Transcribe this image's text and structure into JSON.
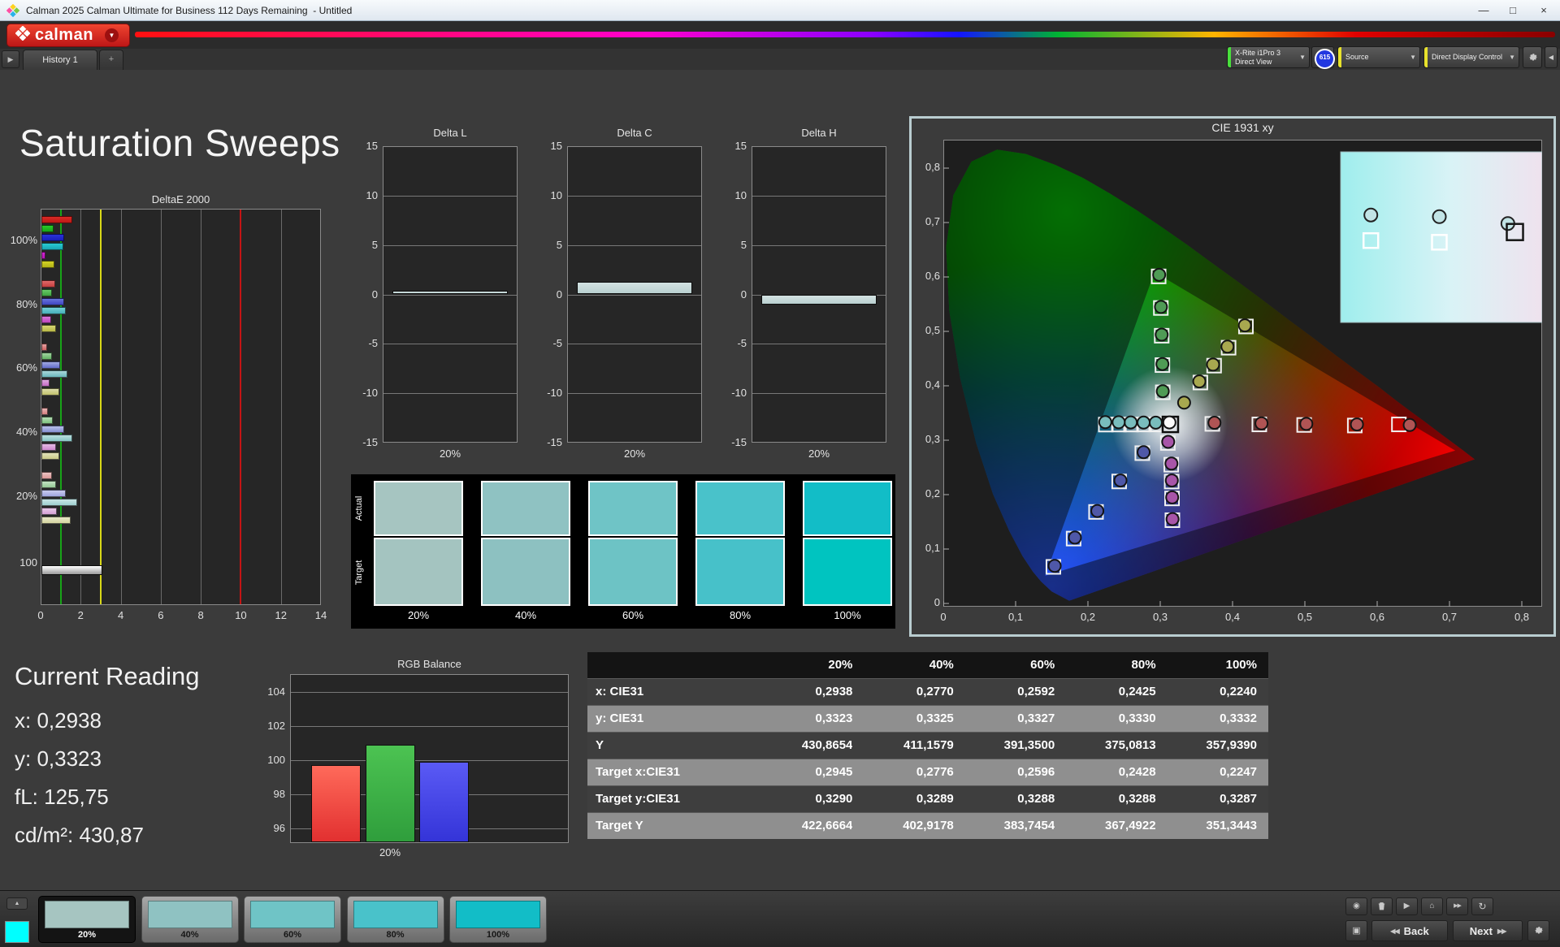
{
  "window": {
    "title": "Calman 2025 Calman Ultimate for Business 112 Days Remaining  - Untitled",
    "minimize": "—",
    "maximize": "□",
    "close": "×"
  },
  "brand": {
    "name": "calman",
    "accent": "#cf1d1d"
  },
  "icons": {
    "chevron_down": "▼",
    "scroll_right": "▶",
    "plus_tab": "+",
    "up": "▲",
    "eye": "◉",
    "play": "▶",
    "home": "⌂",
    "ffwd": "▶▶",
    "refresh": "↻",
    "frame": "▣",
    "rewind": "◀◀",
    "collapse_left": "◀"
  },
  "meter_bar": {
    "meter": {
      "line1": "X-Rite i1Pro 3",
      "line2": "Direct View",
      "badge": "615",
      "stripe": "#49e03c"
    },
    "source": {
      "label": "Source",
      "stripe": "#e8e22c"
    },
    "display": {
      "label": "Direct Display Control",
      "stripe": "#e8e22c"
    }
  },
  "tabs": {
    "history": "History 1"
  },
  "page_title": "Saturation Sweeps",
  "current_reading": {
    "title": "Current Reading",
    "lines": [
      "x: 0,2938",
      "y: 0,3323",
      "fL: 125,75",
      "cd/m²: 430,87"
    ]
  },
  "swatch_panel": {
    "row_labels": [
      "Actual",
      "Target"
    ],
    "levels": [
      "20%",
      "40%",
      "60%",
      "80%",
      "100%"
    ],
    "actual_colors": [
      "#a6c5c1",
      "#8fc2c2",
      "#6fc4c6",
      "#49c2ca",
      "#12bdc7"
    ],
    "target_colors": [
      "#a4c4c0",
      "#8dc1c1",
      "#6dc3c5",
      "#47c1c9",
      "#00c4c0"
    ]
  },
  "table": {
    "columns": [
      "20%",
      "40%",
      "60%",
      "80%",
      "100%"
    ],
    "rows": [
      {
        "label": "x: CIE31",
        "values": [
          "0,2938",
          "0,2770",
          "0,2592",
          "0,2425",
          "0,2240"
        ]
      },
      {
        "label": "y: CIE31",
        "values": [
          "0,3323",
          "0,3325",
          "0,3327",
          "0,3330",
          "0,3332"
        ]
      },
      {
        "label": "Y",
        "values": [
          "430,8654",
          "411,1579",
          "391,3500",
          "375,0813",
          "357,9390"
        ]
      },
      {
        "label": "Target x:CIE31",
        "values": [
          "0,2945",
          "0,2776",
          "0,2596",
          "0,2428",
          "0,2247"
        ]
      },
      {
        "label": "Target y:CIE31",
        "values": [
          "0,3290",
          "0,3289",
          "0,3288",
          "0,3288",
          "0,3287"
        ]
      },
      {
        "label": "Target Y",
        "values": [
          "422,6664",
          "402,9178",
          "383,7454",
          "367,4922",
          "351,3443"
        ]
      }
    ]
  },
  "bottom_bar": {
    "mini_swatch_color": "#00ffff",
    "patches": [
      {
        "label": "20%",
        "color": "#a6c5c1",
        "selected": true
      },
      {
        "label": "40%",
        "color": "#8fc2c2",
        "selected": false
      },
      {
        "label": "60%",
        "color": "#6fc4c6",
        "selected": false
      },
      {
        "label": "80%",
        "color": "#49c2ca",
        "selected": false
      },
      {
        "label": "100%",
        "color": "#12bdc7",
        "selected": false
      }
    ],
    "back_label": "Back",
    "next_label": "Next"
  },
  "chart_data": [
    {
      "id": "deltae2000",
      "type": "bar",
      "orientation": "horizontal",
      "title": "DeltaE 2000",
      "xlim": [
        0,
        14
      ],
      "x_ticks": [
        0,
        2,
        4,
        6,
        8,
        10,
        12,
        14
      ],
      "ref_lines": [
        {
          "value": 1,
          "color": "#18a418"
        },
        {
          "value": 3,
          "color": "#d8d818"
        },
        {
          "value": 10,
          "color": "#c41414"
        }
      ],
      "series_order": [
        "red",
        "green",
        "blue",
        "cyan",
        "magenta",
        "yellow"
      ],
      "groups": [
        {
          "label": "100%",
          "values": [
            1.53,
            0.6,
            1.14,
            1.08,
            0.2,
            0.65
          ],
          "colors": [
            "#c8201c",
            "#1fb41f",
            "#2026c8",
            "#1fb4c0",
            "#c01cc0",
            "#c0c01c"
          ]
        },
        {
          "label": "80%",
          "values": [
            0.67,
            0.54,
            1.14,
            1.21,
            0.47,
            0.74
          ],
          "colors": [
            "#d05050",
            "#50b450",
            "#5058cc",
            "#58bcc4",
            "#c858c8",
            "#c4c458"
          ]
        },
        {
          "label": "60%",
          "values": [
            0.29,
            0.54,
            0.94,
            1.28,
            0.4,
            0.88
          ],
          "colors": [
            "#d87c7c",
            "#7cc07c",
            "#7c84d4",
            "#84c4c8",
            "#d084d0",
            "#cccc84"
          ]
        },
        {
          "label": "40%",
          "values": [
            0.32,
            0.56,
            1.14,
            1.55,
            0.74,
            0.88
          ],
          "colors": [
            "#dc9494",
            "#94cc94",
            "#9aa2dc",
            "#9cd0d0",
            "#d89cd8",
            "#d4d49c"
          ]
        },
        {
          "label": "20%",
          "values": [
            0.54,
            0.74,
            1.21,
            1.79,
            0.79,
            1.48
          ],
          "colors": [
            "#e0a8a8",
            "#a8d4a8",
            "#b0b4e4",
            "#b0d8d8",
            "#dcb0dc",
            "#dcdcb0"
          ]
        },
        {
          "label": "100",
          "values": [
            3.05
          ],
          "colors": [
            "#f2f2f2"
          ]
        }
      ]
    },
    {
      "id": "delta_l",
      "type": "bar",
      "title": "Delta L",
      "categories": [
        "20%"
      ],
      "values": [
        0.4
      ],
      "ylim": [
        -15,
        15
      ],
      "y_ticks": [
        15,
        10,
        5,
        0,
        -5,
        -10,
        -15
      ],
      "bar_color": "#b9d0d0"
    },
    {
      "id": "delta_c",
      "type": "bar",
      "title": "Delta C",
      "categories": [
        "20%"
      ],
      "values": [
        1.25
      ],
      "ylim": [
        -15,
        15
      ],
      "y_ticks": [
        15,
        10,
        5,
        0,
        -5,
        -10,
        -15
      ],
      "bar_color": "#b9d0d0"
    },
    {
      "id": "delta_h",
      "type": "bar",
      "title": "Delta H",
      "categories": [
        "20%"
      ],
      "values": [
        -1.0
      ],
      "ylim": [
        -15,
        15
      ],
      "y_ticks": [
        15,
        10,
        5,
        0,
        -5,
        -10,
        -15
      ],
      "bar_color": "#b9d0d0"
    },
    {
      "id": "rgb_balance",
      "type": "bar",
      "title": "RGB Balance",
      "categories": [
        "20%"
      ],
      "ylim": [
        95,
        105.1
      ],
      "y_ticks": [
        104,
        102,
        100,
        98,
        96
      ],
      "series": [
        {
          "name": "Red",
          "value": 99.7,
          "color": "#e23030",
          "color2": "#ff6a5a"
        },
        {
          "name": "Green",
          "value": 100.9,
          "color": "#2f9e3c",
          "color2": "#4cc352"
        },
        {
          "name": "Blue",
          "value": 99.9,
          "color": "#3434d8",
          "color2": "#5a5af5"
        }
      ]
    },
    {
      "id": "cie1931",
      "type": "scatter",
      "title": "CIE 1931 xy",
      "xlim": [
        0,
        0.8
      ],
      "ylim": [
        0,
        0.8
      ],
      "x_tick_labels": [
        "0",
        "0,1",
        "0,2",
        "0,3",
        "0,4",
        "0,5",
        "0,6",
        "0,7",
        "0,8"
      ],
      "y_tick_labels": [
        "0",
        "0,1",
        "0,2",
        "0,3",
        "0,4",
        "0,5",
        "0,6",
        "0,7",
        "0,8"
      ],
      "white_point": {
        "measured": [
          0.3127,
          0.3327
        ],
        "target": [
          0.314,
          0.329
        ]
      },
      "gamut_triangle": [
        [
          0.292,
          0.609
        ],
        [
          0.708,
          0.281
        ],
        [
          0.141,
          0.051
        ]
      ],
      "locus": [
        [
          0.1741,
          0.005
        ],
        [
          0.15,
          0.022
        ],
        [
          0.1355,
          0.04
        ],
        [
          0.1241,
          0.058
        ],
        [
          0.1096,
          0.087
        ],
        [
          0.0913,
          0.133
        ],
        [
          0.0687,
          0.201
        ],
        [
          0.0454,
          0.295
        ],
        [
          0.0235,
          0.413
        ],
        [
          0.0082,
          0.538
        ],
        [
          0.0039,
          0.655
        ],
        [
          0.0139,
          0.75
        ],
        [
          0.0389,
          0.812
        ],
        [
          0.0743,
          0.834
        ],
        [
          0.1142,
          0.826
        ],
        [
          0.1547,
          0.806
        ],
        [
          0.1929,
          0.782
        ],
        [
          0.2296,
          0.754
        ],
        [
          0.2658,
          0.724
        ],
        [
          0.3016,
          0.692
        ],
        [
          0.3373,
          0.659
        ],
        [
          0.3731,
          0.624
        ],
        [
          0.4087,
          0.59
        ],
        [
          0.4441,
          0.555
        ],
        [
          0.4788,
          0.52
        ],
        [
          0.5125,
          0.487
        ],
        [
          0.5448,
          0.454
        ],
        [
          0.5752,
          0.424
        ],
        [
          0.6029,
          0.397
        ],
        [
          0.627,
          0.372
        ],
        [
          0.6482,
          0.351
        ],
        [
          0.6658,
          0.334
        ],
        [
          0.6915,
          0.308
        ],
        [
          0.7079,
          0.292
        ],
        [
          0.719,
          0.281
        ],
        [
          0.7347,
          0.265
        ]
      ],
      "sweeps": [
        {
          "name": "cyan",
          "color": "#79bdbd",
          "measured": [
            [
              0.2938,
              0.3323
            ],
            [
              0.277,
              0.3325
            ],
            [
              0.2592,
              0.3327
            ],
            [
              0.2425,
              0.333
            ],
            [
              0.224,
              0.3332
            ]
          ],
          "targets": [
            [
              0.2945,
              0.329
            ],
            [
              0.2776,
              0.3289
            ],
            [
              0.2596,
              0.3288
            ],
            [
              0.2428,
              0.3288
            ],
            [
              0.2247,
              0.3287
            ]
          ]
        },
        {
          "name": "red",
          "color": "#b05454",
          "measured": [
            [
              0.375,
              0.332
            ],
            [
              0.44,
              0.331
            ],
            [
              0.502,
              0.33
            ],
            [
              0.572,
              0.329
            ],
            [
              0.645,
              0.328
            ]
          ],
          "targets": [
            [
              0.372,
              0.33
            ],
            [
              0.437,
              0.329
            ],
            [
              0.499,
              0.328
            ],
            [
              0.569,
              0.327
            ],
            [
              0.63,
              0.329
            ]
          ]
        },
        {
          "name": "green",
          "color": "#4f9b55",
          "measured": [
            [
              0.3035,
              0.39
            ],
            [
              0.303,
              0.44
            ],
            [
              0.302,
              0.494
            ],
            [
              0.301,
              0.545
            ],
            [
              0.2985,
              0.604
            ]
          ],
          "targets": [
            [
              0.3035,
              0.388
            ],
            [
              0.303,
              0.438
            ],
            [
              0.302,
              0.492
            ],
            [
              0.3008,
              0.543
            ],
            [
              0.2978,
              0.601
            ]
          ]
        },
        {
          "name": "blue",
          "color": "#4f58a8",
          "measured": [
            [
              0.277,
              0.278
            ],
            [
              0.245,
              0.226
            ],
            [
              0.213,
              0.17
            ],
            [
              0.182,
              0.121
            ],
            [
              0.154,
              0.069
            ]
          ],
          "targets": [
            [
              0.2752,
              0.2762
            ],
            [
              0.2432,
              0.2242
            ],
            [
              0.2112,
              0.1682
            ],
            [
              0.1802,
              0.1192
            ],
            [
              0.1522,
              0.0672
            ]
          ]
        },
        {
          "name": "magenta",
          "color": "#a855a8",
          "measured": [
            [
              0.311,
              0.297
            ],
            [
              0.3155,
              0.257
            ],
            [
              0.316,
              0.226
            ],
            [
              0.3165,
              0.195
            ],
            [
              0.317,
              0.155
            ]
          ],
          "targets": [
            [
              0.3105,
              0.295
            ],
            [
              0.3152,
              0.255
            ],
            [
              0.3158,
              0.224
            ],
            [
              0.3163,
              0.193
            ],
            [
              0.3168,
              0.153
            ]
          ]
        },
        {
          "name": "yellow",
          "color": "#a8a84f",
          "measured": [
            [
              0.333,
              0.369
            ],
            [
              0.354,
              0.408
            ],
            [
              0.373,
              0.439
            ],
            [
              0.393,
              0.472
            ],
            [
              0.417,
              0.511
            ]
          ],
          "targets": [
            [
              0.3555,
              0.406
            ],
            [
              0.3745,
              0.437
            ],
            [
              0.3945,
              0.47
            ],
            [
              0.4185,
              0.509
            ]
          ]
        }
      ],
      "inset": {
        "circles": [
          [
            0.15,
            0.37
          ],
          [
            0.49,
            0.38
          ],
          [
            0.83,
            0.42
          ]
        ],
        "squares": [
          [
            0.15,
            0.52
          ],
          [
            0.49,
            0.53
          ]
        ],
        "black_square": [
          0.865,
          0.47
        ]
      }
    }
  ]
}
